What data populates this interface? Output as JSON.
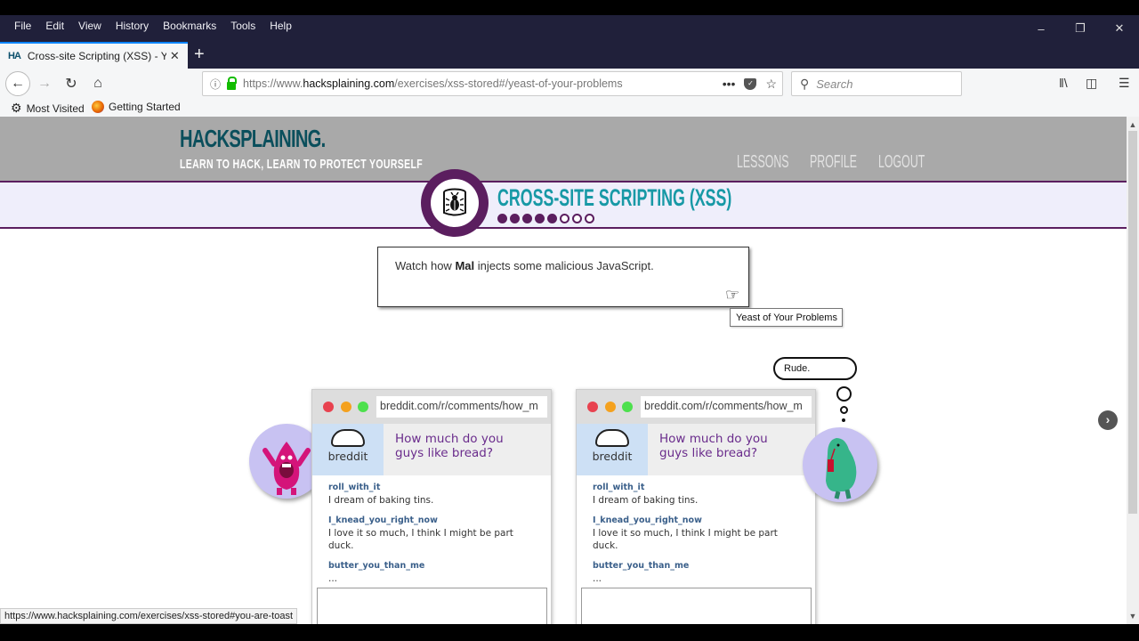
{
  "browser": {
    "menu": [
      "File",
      "Edit",
      "View",
      "History",
      "Bookmarks",
      "Tools",
      "Help"
    ],
    "tab": {
      "favicon": "HA",
      "title": "Cross-site Scripting (XSS) - Yeas",
      "close_icon": "close-icon"
    },
    "new_tab_label": "+",
    "url": {
      "prefix": "https://www.",
      "domain": "hacksplaining.com",
      "path": "/exercises/xss-stored#/yeast-of-your-problems"
    },
    "search_placeholder": "Search",
    "bookmarks": [
      {
        "icon": "gear-icon",
        "label": "Most Visited"
      },
      {
        "icon": "firefox-icon",
        "label": "Getting Started"
      }
    ],
    "status_url": "https://www.hacksplaining.com/exercises/xss-stored#you-are-toast"
  },
  "site": {
    "logo": "HACKSPLAINING.",
    "tagline": "LEARN TO HACK, LEARN TO PROTECT YOURSELF",
    "nav": [
      "LESSONS",
      "PROFILE",
      "LOGOUT"
    ],
    "lesson_title": "CROSS-SITE SCRIPTING (XSS)",
    "progress": {
      "completed": 5,
      "total": 8
    },
    "accent": "#5b1e5f",
    "title_color": "#1899a6"
  },
  "instruction": {
    "before": "Watch how ",
    "name": "Mal",
    "after": " injects some malicious JavaScript.",
    "next_tooltip": "Yeast of Your Problems"
  },
  "thought_bubble": "Rude.",
  "panels": [
    {
      "url": "breddit.com/r/comments/how_m",
      "site_name": "breddit",
      "question": "How much do you guys like bread?",
      "comments": [
        {
          "user": "roll_with_it",
          "text": "I dream of baking tins."
        },
        {
          "user": "I_knead_you_right_now",
          "text": "I love it so much, I think I might be part duck."
        },
        {
          "user": "butter_you_than_me",
          "text": "..."
        }
      ]
    },
    {
      "url": "breddit.com/r/comments/how_m",
      "site_name": "breddit",
      "question": "How much do you guys like bread?",
      "comments": [
        {
          "user": "roll_with_it",
          "text": "I dream of baking tins."
        },
        {
          "user": "I_knead_you_right_now",
          "text": "I love it so much, I think I might be part duck."
        },
        {
          "user": "butter_you_than_me",
          "text": "..."
        }
      ]
    }
  ]
}
